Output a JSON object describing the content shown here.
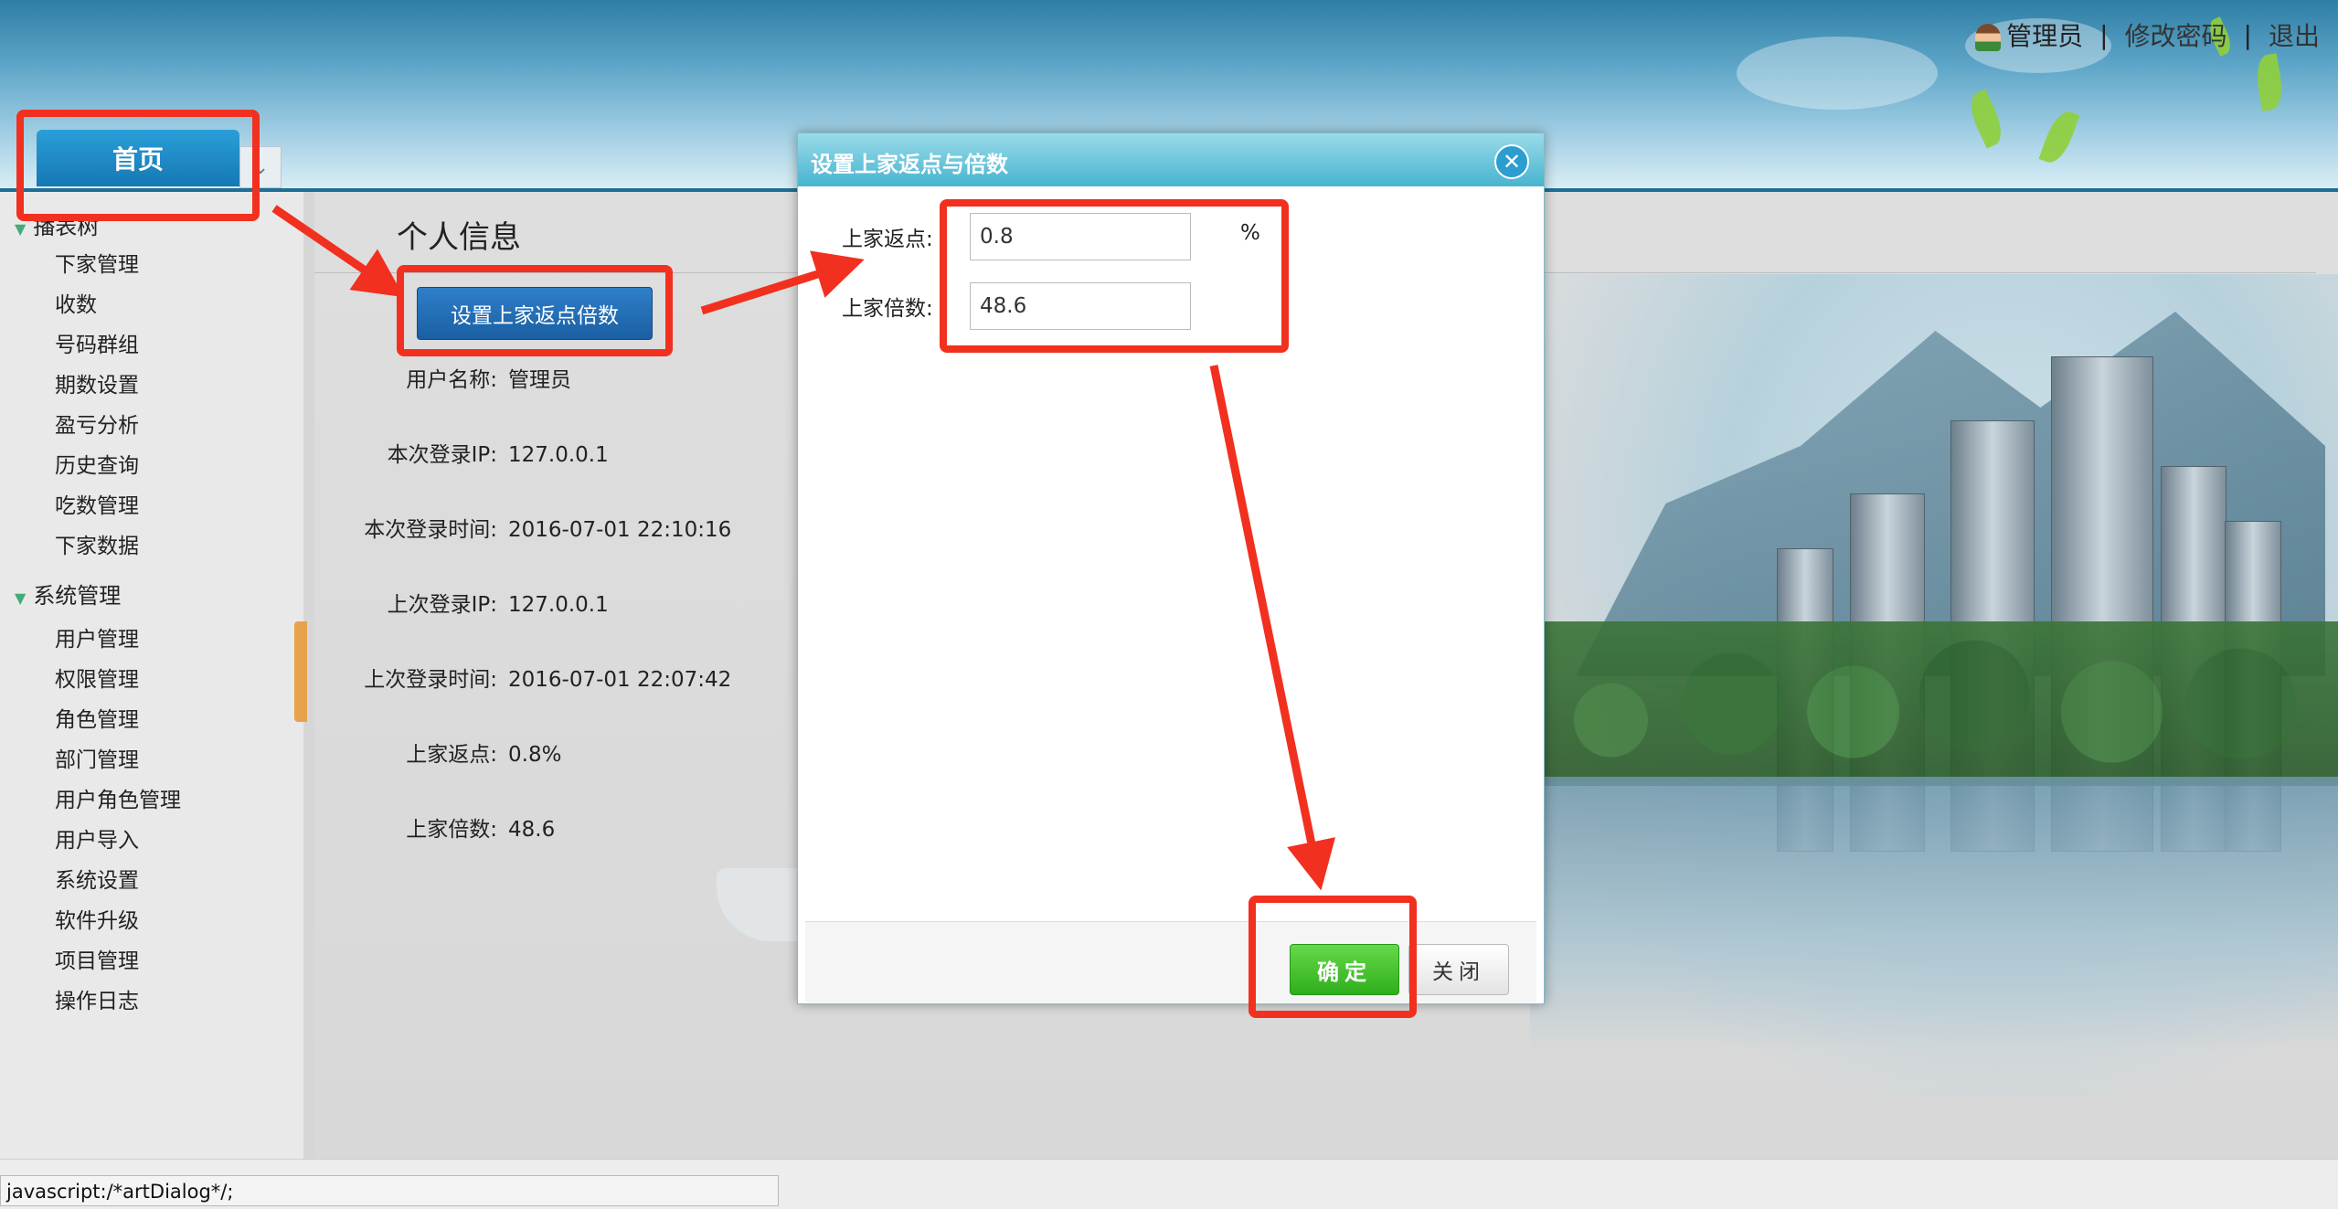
{
  "header": {
    "user_label": "管理员",
    "change_password": "修改密码",
    "logout": "退出",
    "separator": "|"
  },
  "tabs": {
    "home": "首页",
    "dropdown_icon": "chevron-down-icon"
  },
  "sidebar": {
    "group1": {
      "label": "播表树",
      "items": [
        "下家管理",
        "收数",
        "号码群组",
        "期数设置",
        "盈亏分析",
        "历史查询",
        "吃数管理",
        "下家数据"
      ]
    },
    "group2": {
      "label": "系统管理",
      "items": [
        "用户管理",
        "权限管理",
        "角色管理",
        "部门管理",
        "用户角色管理",
        "用户导入",
        "系统设置",
        "软件升级",
        "项目管理",
        "操作日志"
      ]
    }
  },
  "main": {
    "page_title": "个人信息",
    "set_button": "设置上家返点倍数",
    "info": [
      {
        "label": "用户名称:",
        "value": "管理员"
      },
      {
        "label": "本次登录IP:",
        "value": "127.0.0.1"
      },
      {
        "label": "本次登录时间:",
        "value": "2016-07-01 22:10:16"
      },
      {
        "label": "上次登录IP:",
        "value": "127.0.0.1"
      },
      {
        "label": "上次登录时间:",
        "value": "2016-07-01 22:07:42"
      },
      {
        "label": "上家返点:",
        "value": "0.8%"
      },
      {
        "label": "上家倍数:",
        "value": "48.6"
      }
    ]
  },
  "dialog": {
    "title": "设置上家返点与倍数",
    "rebate_label": "上家返点:",
    "rebate_value": "0.8",
    "rebate_unit": "%",
    "multiple_label": "上家倍数:",
    "multiple_value": "48.6",
    "ok_button": "确定",
    "close_button": "关闭",
    "close_icon": "close-icon"
  },
  "status_bar": {
    "text": "javascript:/*artDialog*/;"
  },
  "colors": {
    "annotation_red": "#f2301f",
    "dialog_title": "#47b4cf",
    "ok_green": "#2fae1c",
    "button_blue": "#1a5fa3"
  }
}
